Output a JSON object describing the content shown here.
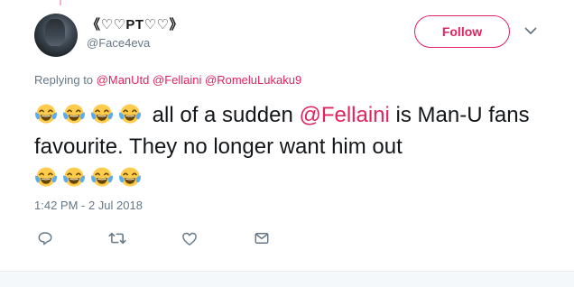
{
  "author": {
    "display_name": "《♡♡PT♡♡》",
    "handle": "@Face4eva"
  },
  "follow_button": {
    "label": "Follow"
  },
  "colors": {
    "accent": "#e0245e",
    "secondary_text": "#657786",
    "primary_text": "#14171a"
  },
  "reply": {
    "prefix": "Replying to",
    "mentions": [
      "@ManUtd",
      "@Fellaini",
      "@RomeluLukaku9"
    ]
  },
  "tweet": {
    "emoji_name": "face-with-tears-of-joy",
    "text_part1": "all of a sudden",
    "mention": "@Fellaini",
    "text_part2": "is Man-U fans favourite. They no longer want him out"
  },
  "timestamp": "1:42 PM - 2 Jul 2018",
  "actions": [
    {
      "icon": "reply-icon"
    },
    {
      "icon": "retweet-icon"
    },
    {
      "icon": "like-icon"
    },
    {
      "icon": "direct-message-icon"
    }
  ]
}
